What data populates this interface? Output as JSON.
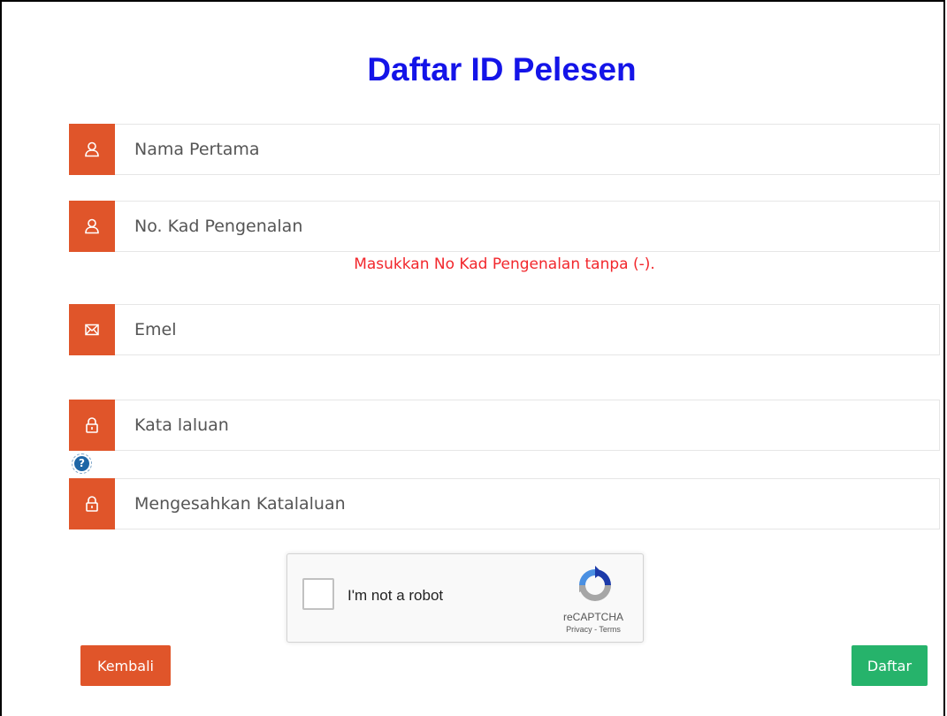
{
  "page": {
    "title": "Daftar ID Pelesen"
  },
  "form": {
    "first_name": {
      "placeholder": "Nama Pertama",
      "icon": "user-icon"
    },
    "ic_number": {
      "placeholder": "No. Kad Pengenalan",
      "icon": "user-icon"
    },
    "ic_hint": "Masukkan No Kad Pengenalan tanpa (-).",
    "email": {
      "placeholder": "Emel",
      "icon": "envelope-icon"
    },
    "password": {
      "placeholder": "Kata laluan",
      "icon": "lock-icon"
    },
    "help": "?",
    "confirm_password": {
      "placeholder": "Mengesahkan Katalaluan",
      "icon": "lock-icon"
    }
  },
  "captcha": {
    "label": "I'm not a robot",
    "brand": "reCAPTCHA",
    "links": "Privacy - Terms"
  },
  "buttons": {
    "back": "Kembali",
    "submit": "Daftar"
  },
  "colors": {
    "title": "#1414e8",
    "addon": "#e0552a",
    "hint": "#f2272c",
    "back_button": "#e0552a",
    "submit_button": "#26b36b"
  }
}
